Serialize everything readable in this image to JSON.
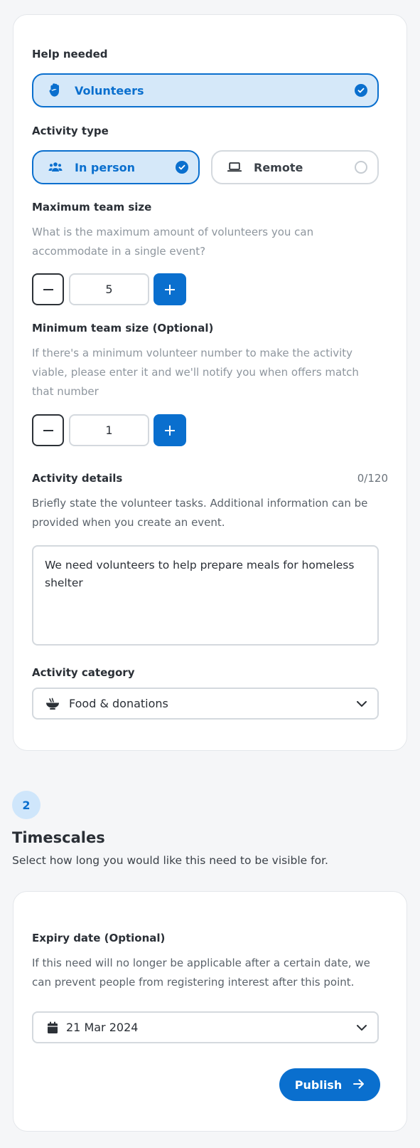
{
  "help_needed": {
    "label": "Help needed",
    "option": {
      "label": "Volunteers",
      "icon": "hand-icon",
      "selected": true
    }
  },
  "activity_type": {
    "label": "Activity type",
    "options": [
      {
        "label": "In person",
        "icon": "people-icon",
        "selected": true
      },
      {
        "label": "Remote",
        "icon": "laptop-icon",
        "selected": false
      }
    ]
  },
  "max_team": {
    "label": "Maximum team size",
    "help": "What is the maximum amount of volunteers you can accommodate in a single event?",
    "value": "5"
  },
  "min_team": {
    "label": "Minimum team size (Optional)",
    "help": "If there's a minimum volunteer number to make the activity viable, please enter it and we'll notify you when offers match that number",
    "value": "1"
  },
  "details": {
    "label": "Activity details",
    "counter": "0/120",
    "help": "Briefly state the volunteer tasks. Additional information can be provided when you create an event.",
    "value": "We need volunteers to help prepare meals for homeless shelter"
  },
  "category": {
    "label": "Activity category",
    "value": "Food & donations",
    "icon": "bowl-icon"
  },
  "timescales": {
    "step": "2",
    "title": "Timescales",
    "subtitle": "Select how long you would like this need to be visible for."
  },
  "expiry": {
    "label": "Expiry date (Optional)",
    "help": "If this need will no longer be applicable after a certain date, we can prevent people from registering interest after this point.",
    "value": "21 Mar 2024",
    "icon": "calendar-icon"
  },
  "publish_label": "Publish",
  "colors": {
    "primary": "#0a6fce",
    "selected_bg": "#d5e8f9",
    "badge_bg": "#cfe6fb",
    "page_bg": "#f5f6f8"
  }
}
